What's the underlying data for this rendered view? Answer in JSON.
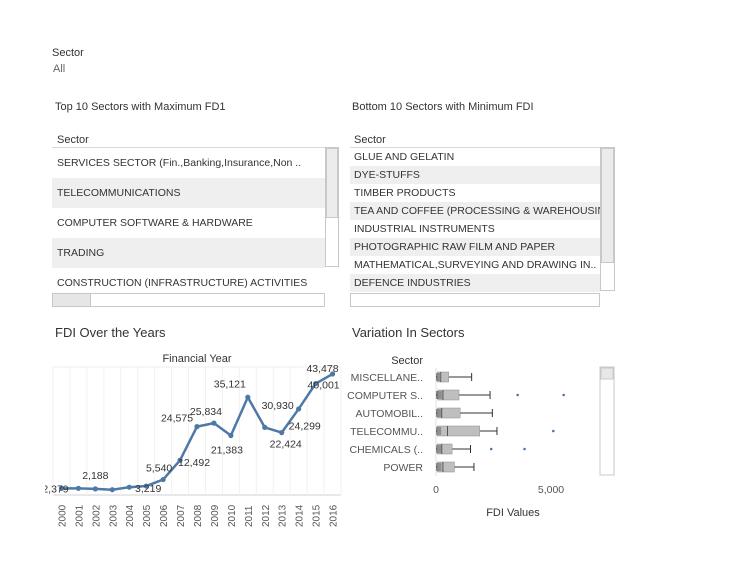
{
  "filter": {
    "label": "Sector",
    "value": "All"
  },
  "top_table": {
    "title": "Top 10 Sectors with Maximum FD1",
    "header": "Sector",
    "rows": [
      "SERVICES SECTOR (Fin.,Banking,Insurance,Non ..",
      "TELECOMMUNICATIONS",
      "COMPUTER SOFTWARE & HARDWARE",
      "TRADING",
      "CONSTRUCTION (INFRASTRUCTURE) ACTIVITIES"
    ]
  },
  "bottom_table": {
    "title": "Bottom 10 Sectors with Minimum FDI",
    "header": "Sector",
    "rows": [
      "GLUE AND GELATIN",
      "DYE-STUFFS",
      "TIMBER PRODUCTS",
      "TEA AND COFFEE (PROCESSING & WAREHOUSIN..",
      "INDUSTRIAL INSTRUMENTS",
      "PHOTOGRAPHIC RAW FILM AND PAPER",
      "MATHEMATICAL,SURVEYING AND DRAWING IN..",
      "DEFENCE INDUSTRIES"
    ]
  },
  "chart_data": [
    {
      "type": "line",
      "title": "FDI Over the Years",
      "xlabel": "Financial Year",
      "ylabel": "",
      "x": [
        "2000",
        "2001",
        "2002",
        "2003",
        "2004",
        "2005",
        "2006",
        "2007",
        "2008",
        "2009",
        "2010",
        "2011",
        "2012",
        "2013",
        "2014",
        "2015",
        "2016"
      ],
      "series": [
        {
          "values": [
            2379,
            2400,
            2188,
            1900,
            2800,
            3219,
            5540,
            12492,
            24575,
            25834,
            21383,
            35121,
            24299,
            22424,
            30930,
            40001,
            43478
          ]
        }
      ],
      "data_labels": [
        {
          "x": "2000",
          "text": "2,379"
        },
        {
          "x": "2002",
          "text": "2,188"
        },
        {
          "x": "2005",
          "text": "3,219"
        },
        {
          "x": "2006",
          "text": "5,540"
        },
        {
          "x": "2007",
          "text": "12,492"
        },
        {
          "x": "2008",
          "text": "24,575"
        },
        {
          "x": "2009",
          "text": "25,834"
        },
        {
          "x": "2010",
          "text": "21,383"
        },
        {
          "x": "2011",
          "text": "35,121"
        },
        {
          "x": "2013",
          "text": "22,424"
        },
        {
          "x": "2013",
          "text": "24,299"
        },
        {
          "x": "2014",
          "text": "30,930"
        },
        {
          "x": "2015",
          "text": "40,001"
        },
        {
          "x": "2016",
          "text": "43,478"
        }
      ],
      "ylim": [
        0,
        46000
      ],
      "line_color": "#4e79a7"
    },
    {
      "type": "boxplot",
      "title": "Variation In Sectors",
      "xlabel": "FDI Values",
      "ylabel": "Sector",
      "categories": [
        "MISCELLANE..",
        "COMPUTER S..",
        "AUTOMOBIL..",
        "TELECOMMU..",
        "CHEMICALS (..",
        "POWER"
      ],
      "x_ticks": [
        "0",
        "5,000"
      ],
      "xlim": [
        0,
        7000
      ],
      "boxes": [
        {
          "name": "MISCELLANE..",
          "q1": 60,
          "median": 200,
          "q3": 550,
          "whisker_low": 0,
          "whisker_high": 1550,
          "outliers": []
        },
        {
          "name": "COMPUTER S..",
          "q1": 80,
          "median": 300,
          "q3": 1000,
          "whisker_low": 0,
          "whisker_high": 2350,
          "outliers": [
            3550,
            5550
          ]
        },
        {
          "name": "AUTOMOBIL..",
          "q1": 60,
          "median": 250,
          "q3": 1050,
          "whisker_low": 0,
          "whisker_high": 2450,
          "outliers": []
        },
        {
          "name": "TELECOMMU..",
          "q1": 50,
          "median": 500,
          "q3": 1900,
          "whisker_low": 0,
          "whisker_high": 2650,
          "outliers": [
            5100
          ]
        },
        {
          "name": "CHEMICALS (..",
          "q1": 50,
          "median": 250,
          "q3": 700,
          "whisker_low": 0,
          "whisker_high": 1500,
          "outliers": [
            2400,
            3850
          ]
        },
        {
          "name": "POWER",
          "q1": 60,
          "median": 300,
          "q3": 800,
          "whisker_low": 0,
          "whisker_high": 1650,
          "outliers": []
        }
      ],
      "box_color": "#bfbfbf",
      "outlier_color": "#4e79a7"
    }
  ]
}
